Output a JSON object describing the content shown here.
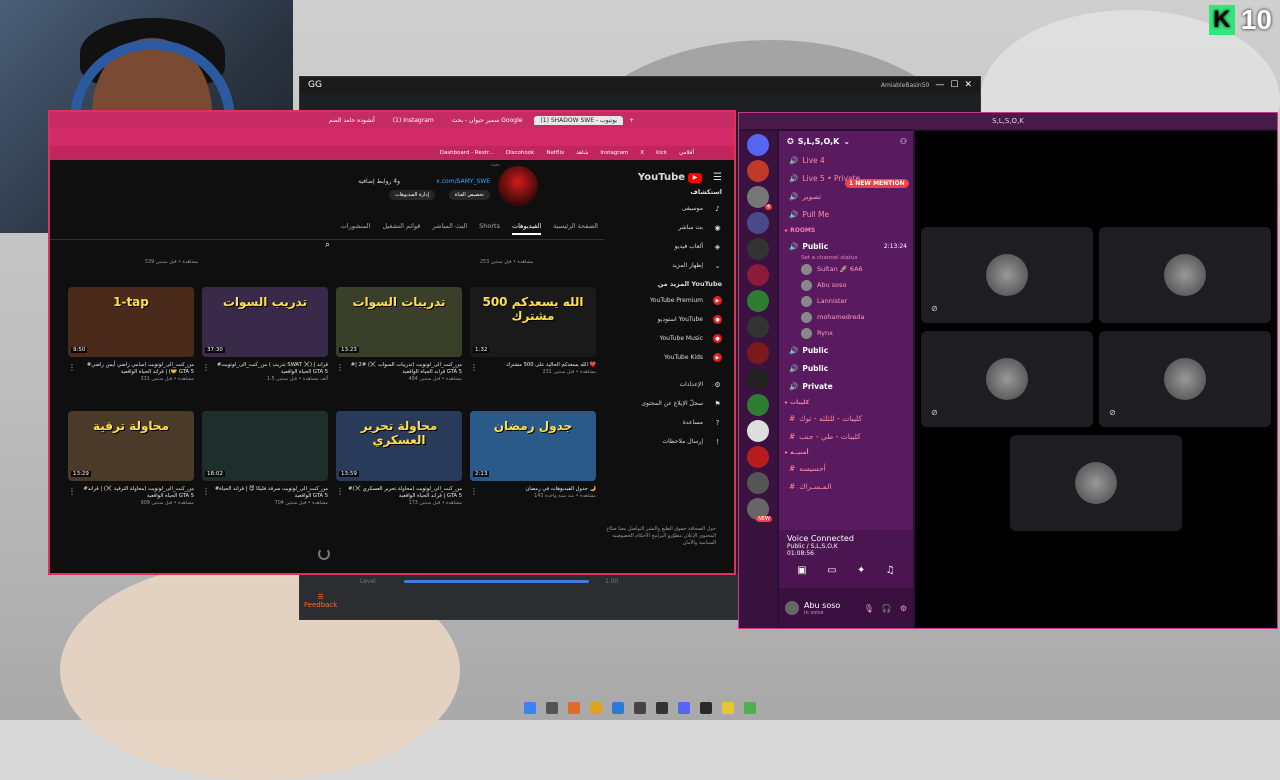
{
  "overlay": {
    "brand_letter": "K",
    "count": "10"
  },
  "gg_window": {
    "title": "GG",
    "user": "AmiableBasin50",
    "feedback": "Feedback",
    "level_label": "Level",
    "level_value": "1.00"
  },
  "browser": {
    "tabs": [
      "أنشوده حامد الضم",
      "(1) Instagram",
      "سمير حيوان - بحث Google",
      "(1) SHADOW SWE - يوتيوب"
    ],
    "bookmarks": [
      "Dashboard - Restr...",
      "Discohook",
      "Netflix",
      "شاهد",
      "Instagram",
      "X",
      "kick",
      "أفلامي"
    ]
  },
  "youtube": {
    "logo": "YouTube",
    "country": "SA",
    "channel_link": "x.com/SAMY_SWE",
    "channel_links_more": "و4 روابط إضافية",
    "btn_customize": "تخصيص القناة",
    "btn_manage": "إدارة الفيديوهات",
    "search_placeholder": "بحث",
    "tabs": [
      "الصفحة الرئيسية",
      "الفيديوهات",
      "Shorts",
      "البث المباشر",
      "قوائم التشغيل",
      "المنشورات"
    ],
    "sidebar": {
      "explore_header": "استكشاف",
      "explore": [
        "موسيقى",
        "بث مباشر",
        "ألعاب فيديو",
        "إظهار المزيد"
      ],
      "more_header": "المزيد من YouTube",
      "more": [
        "YouTube Premium",
        "استوديو YouTube",
        "YouTube Music",
        "YouTube Kids"
      ],
      "settings": [
        "الإعدادات",
        "سجلّ الإبلاغ عن المحتوى",
        "مساعدة",
        "إرسال ملاحظات"
      ],
      "footer": "حول  الصحافة  حقوق الطبع والنشر  التواصل معنا  صنّاع المحتوى  الإعلان  مطوّرو البرامج  الأحكام  الخصوصية  السياسة والأمان"
    },
    "prev_row_meta": [
      "253 مشاهدة • قبل سنتين",
      "539 مشاهدة • قبل سنتين"
    ],
    "videos": [
      {
        "thumb_text": "الله يسعدكم 500 مشترك",
        "duration": "1:32",
        "title": "الله يسعدكم الحالية على 500 مشترك ❤️",
        "meta": "231 مشاهدة • قبل سنتين"
      },
      {
        "thumb_text": "تدريبات السوات",
        "duration": "13:23",
        "title": "#من_كنت_الى_لوتويت (تدريبات السوات ⚔️) #2 | قراند الحياة الواقعية GTA 5",
        "meta": "484 مشاهدة • قبل سنتين"
      },
      {
        "thumb_text": "تدريب السوات",
        "duration": "37:30",
        "title": "#من_كنت_الى_لوتويت ( تدريب SWAT ⚔️) | قراند الحياة الواقعية GTA 5",
        "meta": "1.5 ألف مشاهدة • قبل سنتين"
      },
      {
        "thumb_text": "1-tap",
        "duration": "9:50",
        "title": "#من_كنت_الى_لوتويت (سامي راضي أيمن راضي 🤝) | قراند الحياة الواقعية GTA 5",
        "meta": "331 مشاهدة • قبل سنتين"
      },
      {
        "thumb_text": "جدول رمضان",
        "duration": "2:13",
        "title": "جدول الفيديوهات في رمضان 🌙",
        "meta": "143 مشاهدة • منذ سنة واحدة"
      },
      {
        "thumb_text": "محاولة تحرير العسكري",
        "duration": "13:59",
        "title": "#من_كنت_الى_لوتويت (محاولة تحرير العسكري ⚔️) | قراند الحياة الواقعية GTA 5",
        "meta": "173 مشاهدة • قبل سنتين"
      },
      {
        "thumb_text": "",
        "duration": "18:02",
        "title": "#من_كنت_الى_لوتويت سرقة فليكا 😈 | قراند الحياة الواقعية GTA 5",
        "meta": "704 مشاهدة • قبل سنتين"
      },
      {
        "thumb_text": "محاولة ترقية",
        "duration": "13:29",
        "title": "#من_كنت_الى_لوتويت (محاولة الترقية ⚔️) | قراند الحياة الواقعية GTA 5",
        "meta": "909 مشاهدة • قبل سنتين"
      }
    ]
  },
  "discord": {
    "title": "S,L,S,O,K",
    "server_name": "S,L,S,O,K",
    "mention_badge": "1 NEW MENTION",
    "channels_top": [
      "Live 4",
      "Live 5 • Private",
      "تصوير",
      "Pull Me"
    ],
    "rooms_category": "ROOMS",
    "voice_public": "Public",
    "voice_time": "2:13:24",
    "status_hint": "Set a channel status",
    "members": [
      "Sultan 🚀 6A6",
      "Abu soso",
      "Lannister",
      "mohamedreda",
      "Rynx"
    ],
    "voice_more": [
      "Public",
      "Public",
      "Private"
    ],
    "text_category": "كليبات",
    "text_channels": [
      "كليبات - للثلثه - توك",
      "كليبات - طي - جنب"
    ],
    "extra_category": "أمنيــه",
    "extra_channels": [
      "أحسيسه",
      "المـسـراك"
    ],
    "voice_connected": "Voice Connected",
    "voice_sub": "Public / S,L,S,O,K",
    "voice_timer": "01:08:56",
    "user_name": "Abu soso",
    "user_status": "In voice",
    "new_badge": "NEW"
  },
  "colors": {
    "discord_accent": "#c73a8a",
    "youtube_red": "#ff0000",
    "browser_accent": "#d22a66"
  }
}
